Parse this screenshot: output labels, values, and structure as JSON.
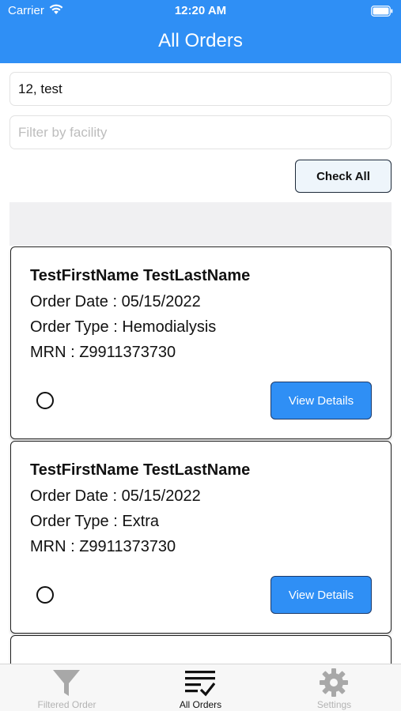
{
  "status_bar": {
    "carrier": "Carrier",
    "time": "12:20 AM"
  },
  "header": {
    "title": "All Orders"
  },
  "search": {
    "value": "12, test"
  },
  "facility": {
    "placeholder": "Filter by facility",
    "value": ""
  },
  "check_all_label": "Check All",
  "orders": [
    {
      "name": "TestFirstName TestLastName",
      "order_date": "Order Date : 05/15/2022",
      "order_type": "Order Type : Hemodialysis",
      "mrn": "MRN : Z9911373730",
      "selected": false,
      "button_label": "View Details"
    },
    {
      "name": "TestFirstName TestLastName",
      "order_date": "Order Date : 05/15/2022",
      "order_type": "Order Type : Extra",
      "mrn": "MRN : Z9911373730",
      "selected": false,
      "button_label": "View Details"
    }
  ],
  "tabs": [
    {
      "label": "Filtered Order",
      "icon": "funnel-icon",
      "active": false
    },
    {
      "label": "All Orders",
      "icon": "checklist-icon",
      "active": true
    },
    {
      "label": "Settings",
      "icon": "gear-icon",
      "active": false
    }
  ],
  "colors": {
    "accent": "#2f8ff5",
    "tab_inactive": "#b3b3b3",
    "band_gray": "#f0f0f2"
  }
}
